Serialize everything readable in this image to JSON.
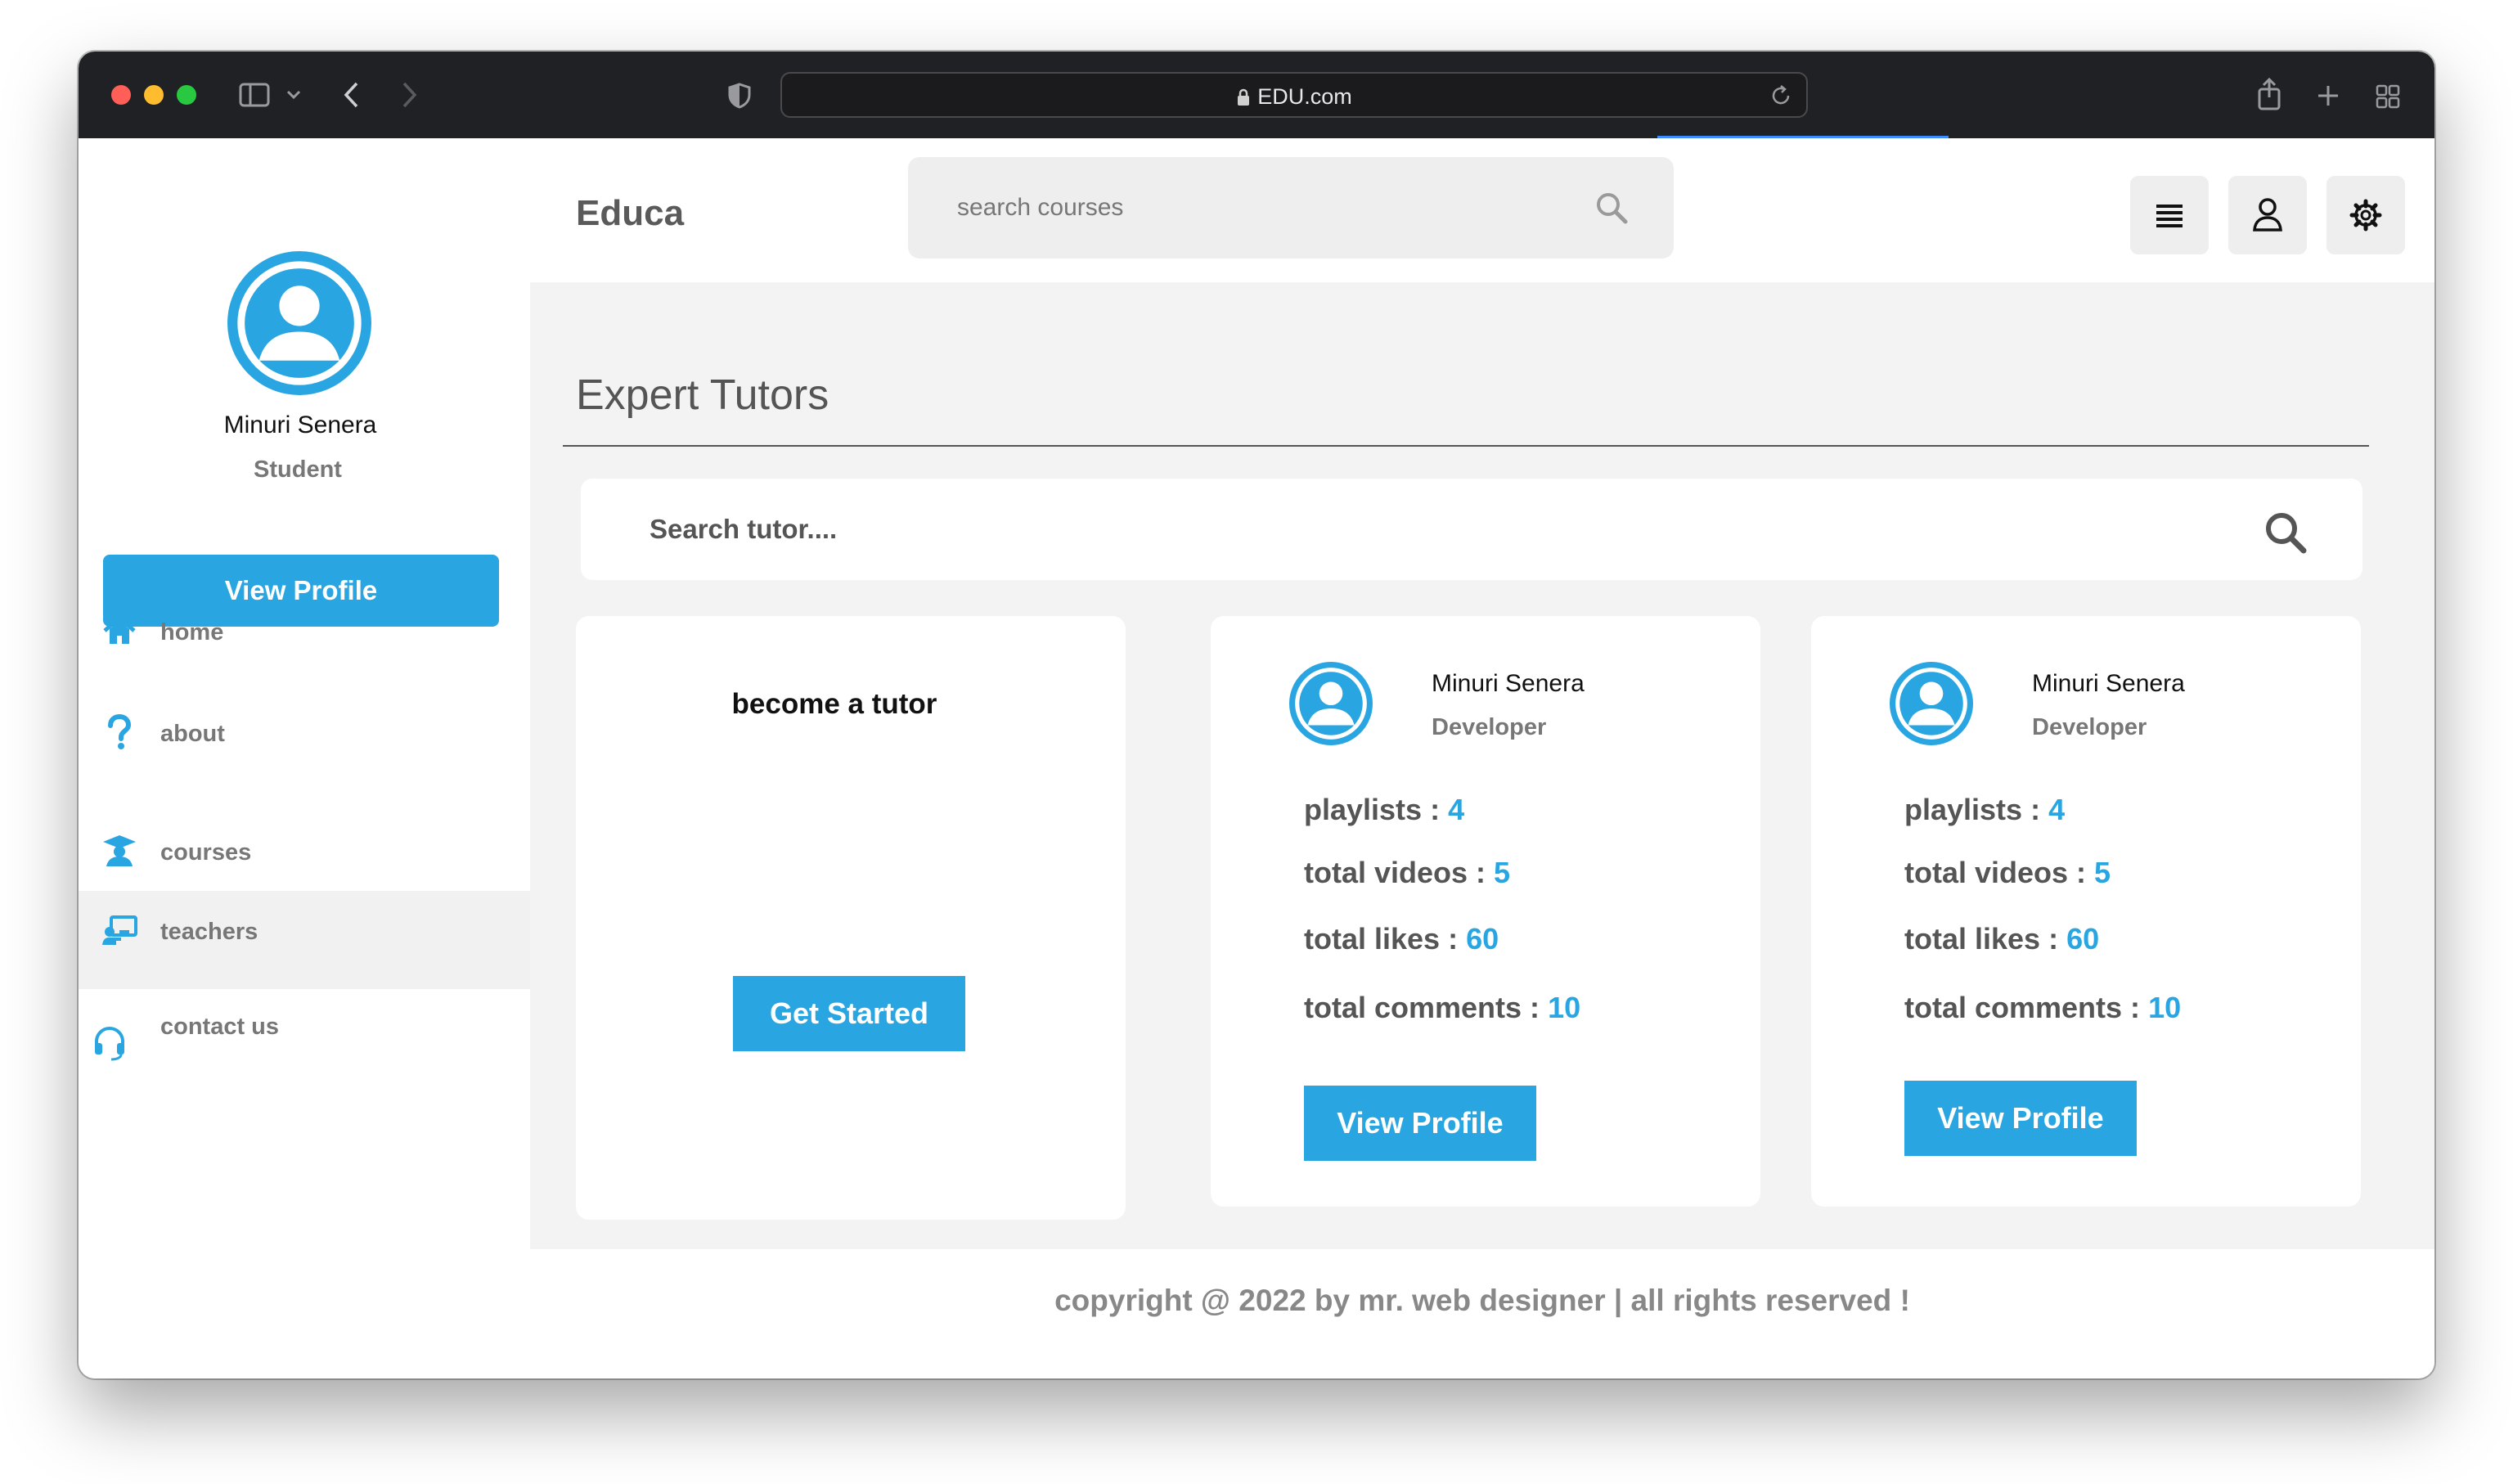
{
  "browser": {
    "url": "EDU.com",
    "traffic_lights": {
      "close": "#ff5f57",
      "minimize": "#febc2e",
      "zoom": "#28c840"
    }
  },
  "sidebar": {
    "user_name": "Minuri Senera",
    "user_role": "Student",
    "view_profile_label": "View Profile",
    "nav": [
      {
        "label": "home",
        "icon": "home-icon"
      },
      {
        "label": "about",
        "icon": "question-icon"
      },
      {
        "label": "courses",
        "icon": "graduation-cap-icon"
      },
      {
        "label": "teachers",
        "icon": "chalkboard-teacher-icon",
        "active": true
      },
      {
        "label": "contact us",
        "icon": "headset-icon"
      }
    ]
  },
  "header": {
    "brand": "Educa",
    "search_placeholder": "search courses",
    "icons": [
      "menu-icon",
      "user-icon",
      "settings-icon"
    ]
  },
  "main": {
    "heading": "Expert Tutors",
    "search_placeholder": "Search tutor....",
    "become_card": {
      "title": "become a tutor",
      "button": "Get Started"
    },
    "tutors": [
      {
        "name": "Minuri Senera",
        "role": "Developer",
        "stats": [
          {
            "label": "playlists :",
            "value": "4"
          },
          {
            "label": "total videos :",
            "value": "5"
          },
          {
            "label": "total likes :",
            "value": "60"
          },
          {
            "label": "total comments :",
            "value": "10"
          }
        ],
        "button": "View Profile"
      },
      {
        "name": "Minuri Senera",
        "role": "Developer",
        "stats": [
          {
            "label": "playlists :",
            "value": "4"
          },
          {
            "label": "total videos :",
            "value": "5"
          },
          {
            "label": "total likes :",
            "value": "60"
          },
          {
            "label": "total comments :",
            "value": "10"
          }
        ],
        "button": "View Profile"
      }
    ]
  },
  "footer": {
    "text": "copyright @ 2022 by mr. web designer | all rights reserved !"
  },
  "colors": {
    "accent": "#29a6e1",
    "sidebar_active_bg": "#f1f1f1",
    "main_bg": "#f3f3f3"
  }
}
